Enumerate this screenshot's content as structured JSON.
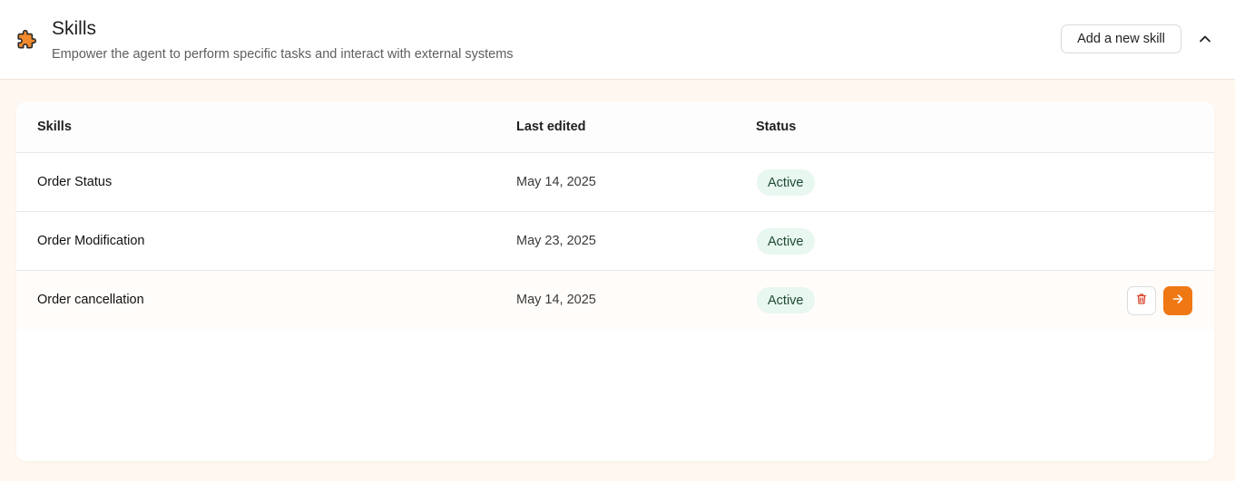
{
  "header": {
    "title": "Skills",
    "subtitle": "Empower the agent to perform specific tasks and interact with external systems",
    "add_button_label": "Add a new skill",
    "icon": "puzzle-icon",
    "collapse_icon": "chevron-up-icon"
  },
  "table": {
    "columns": [
      "Skills",
      "Last edited",
      "Status"
    ],
    "rows": [
      {
        "name": "Order Status",
        "last_edited": "May 14, 2025",
        "status": "Active"
      },
      {
        "name": "Order Modification",
        "last_edited": "May 23, 2025",
        "status": "Active"
      },
      {
        "name": "Order cancellation",
        "last_edited": "May 14, 2025",
        "status": "Active"
      }
    ]
  },
  "row_actions": {
    "delete_icon": "trash-icon",
    "open_icon": "arrow-right-icon"
  },
  "colors": {
    "accent": "#f07814",
    "page_background": "#fff7f0",
    "status_active_bg": "#e8f7ef",
    "delete_icon": "#d9442f"
  }
}
